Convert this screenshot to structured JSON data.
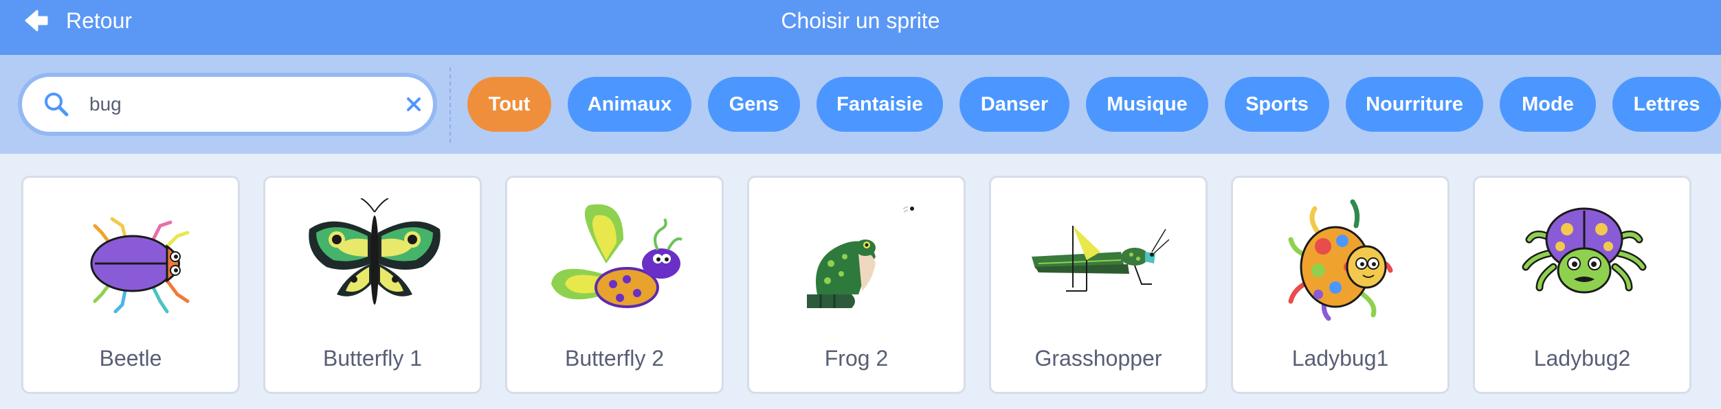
{
  "header": {
    "back_label": "Retour",
    "title": "Choisir un sprite",
    "back_icon": "arrow-left-icon"
  },
  "search": {
    "value": "bug",
    "search_icon": "search-icon",
    "clear_icon": "close-icon"
  },
  "categories": [
    {
      "label": "Tout",
      "active": true
    },
    {
      "label": "Animaux",
      "active": false
    },
    {
      "label": "Gens",
      "active": false
    },
    {
      "label": "Fantaisie",
      "active": false
    },
    {
      "label": "Danser",
      "active": false
    },
    {
      "label": "Musique",
      "active": false
    },
    {
      "label": "Sports",
      "active": false
    },
    {
      "label": "Nourriture",
      "active": false
    },
    {
      "label": "Mode",
      "active": false
    },
    {
      "label": "Lettres",
      "active": false
    }
  ],
  "sprites": [
    {
      "name": "Beetle"
    },
    {
      "name": "Butterfly 1"
    },
    {
      "name": "Butterfly 2"
    },
    {
      "name": "Frog 2"
    },
    {
      "name": "Grasshopper"
    },
    {
      "name": "Ladybug1"
    },
    {
      "name": "Ladybug2"
    }
  ],
  "colors": {
    "header": "#5b98f5",
    "filterbar": "#b3ccf5",
    "pill": "#4c97ff",
    "pill_active": "#f08f3b",
    "background": "#e6eef9"
  }
}
